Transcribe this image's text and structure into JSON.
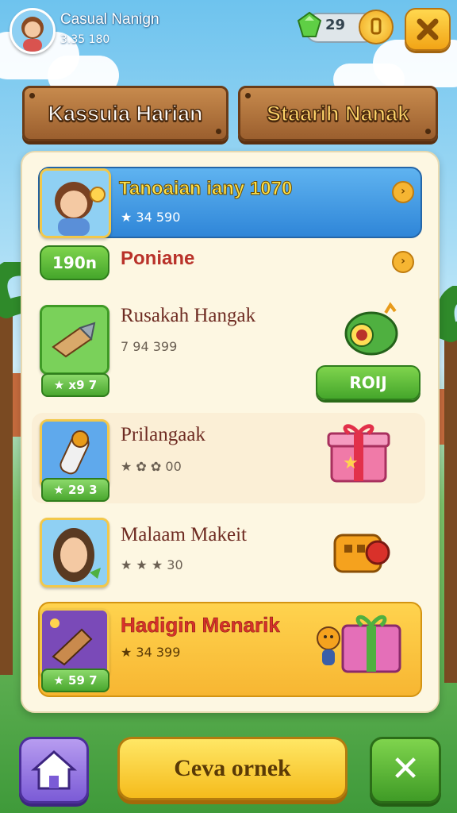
{
  "header": {
    "player_name": "Casual Nanign",
    "player_sub": "3.35 180",
    "gem_count": "29"
  },
  "tabs": [
    {
      "label": "Kassuia Harian",
      "active": true
    },
    {
      "label": "Staarih Nanak",
      "active": false
    }
  ],
  "featured": {
    "title": "Tanoaian iany 1070",
    "sub": "★ 34 590"
  },
  "section": {
    "timer": "190n",
    "title": "Poniane"
  },
  "items": [
    {
      "name": "Rusakah Hangak",
      "sub": "7 94 399",
      "badge": "★ x9  7",
      "action": "ROIJ"
    },
    {
      "name": "Prilangaak",
      "sub": "★ ✿ ✿ 00",
      "badge": "★ 29  3"
    },
    {
      "name": "Malaam Makeit",
      "sub": "★ ★ ★ 30"
    },
    {
      "name": "Hadigin Menarik",
      "sub": "★ 34 399",
      "badge": "★ 59  7"
    }
  ],
  "bottom": {
    "main_label": "Ceva ornek",
    "close_label": "✕"
  },
  "colors": {
    "accent_green": "#45a62b",
    "accent_gold": "#f5bb1c",
    "featured_blue": "#2f86d8",
    "title_red": "#b9322a"
  }
}
